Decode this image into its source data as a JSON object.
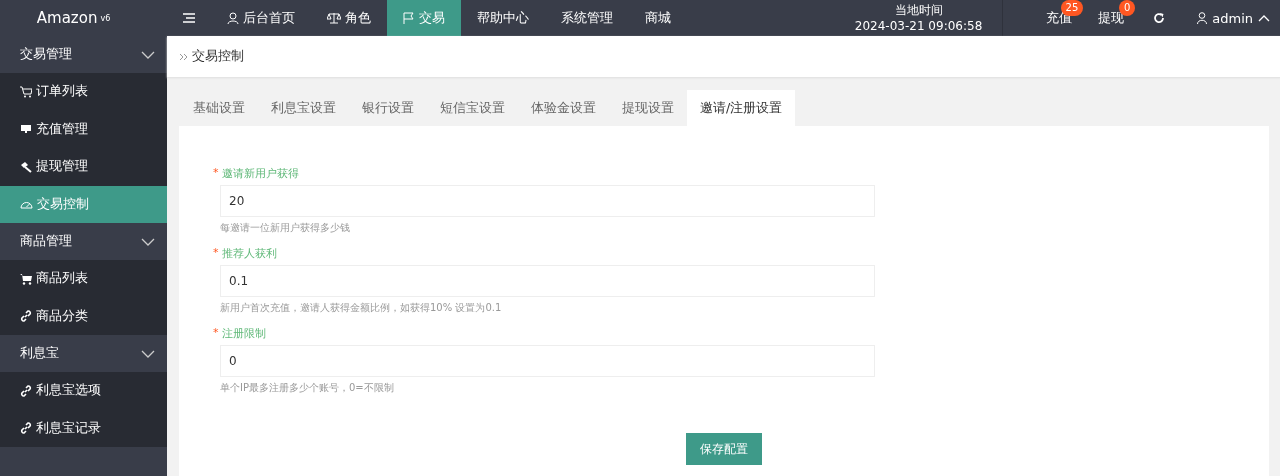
{
  "logo": {
    "text": "Amazon",
    "sup": "v6"
  },
  "nav": [
    {
      "label": "后台首页",
      "selected": false
    },
    {
      "label": "角色",
      "selected": false
    },
    {
      "label": "交易",
      "selected": true
    },
    {
      "label": "帮助中心",
      "selected": false
    },
    {
      "label": "系统管理",
      "selected": false
    },
    {
      "label": "商城",
      "selected": false
    }
  ],
  "clock": {
    "label": "当地时间",
    "time": "2024-03-21 09:06:58"
  },
  "actions": [
    {
      "label": "充值",
      "badge": "25"
    },
    {
      "label": "提现",
      "badge": "0"
    }
  ],
  "user": "admin",
  "sidebar": [
    {
      "label": "交易管理",
      "expanded": true,
      "children": [
        {
          "label": "订单列表",
          "selected": false
        },
        {
          "label": "充值管理",
          "selected": false
        },
        {
          "label": "提现管理",
          "selected": false
        },
        {
          "label": "交易控制",
          "selected": true
        }
      ]
    },
    {
      "label": "商品管理",
      "expanded": true,
      "children": [
        {
          "label": "商品列表",
          "selected": false
        },
        {
          "label": "商品分类",
          "selected": false
        }
      ]
    },
    {
      "label": "利息宝",
      "expanded": true,
      "children": [
        {
          "label": "利息宝选项",
          "selected": false
        },
        {
          "label": "利息宝记录",
          "selected": false
        }
      ]
    }
  ],
  "breadcrumb": "交易控制",
  "tabs": [
    {
      "label": "基础设置",
      "selected": false
    },
    {
      "label": "利息宝设置",
      "selected": false
    },
    {
      "label": "银行设置",
      "selected": false
    },
    {
      "label": "短信宝设置",
      "selected": false
    },
    {
      "label": "体验金设置",
      "selected": false
    },
    {
      "label": "提现设置",
      "selected": false
    },
    {
      "label": "邀请/注册设置",
      "selected": true
    }
  ],
  "fields": [
    {
      "label": "邀请新用户获得",
      "required_mark": "*",
      "value": "20",
      "help": "每邀请一位新用户获得多少钱"
    },
    {
      "label": "推荐人获利",
      "required_mark": "*",
      "value": "0.1",
      "help": "新用户首次充值，邀请人获得金额比例，如获得10% 设置为0.1"
    },
    {
      "label": "注册限制",
      "required_mark": "*",
      "value": "0",
      "help": "单个IP最多注册多少个账号，0=不限制"
    }
  ],
  "save_button": "保存配置"
}
